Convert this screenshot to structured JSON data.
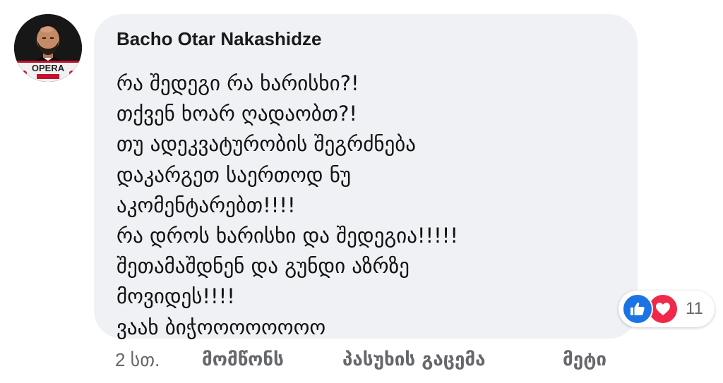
{
  "comment": {
    "author": "Bacho Otar Nakashidze",
    "avatar_text": "OPERA",
    "lines": [
      "რა შედეგი რა ხარისხი?!",
      "თქვენ ხოარ ღადაობთ?!",
      "თუ ადეკვატურობის შეგრძნება",
      "დაკარგეთ საერთოდ ნუ",
      "აკომენტარებთ!!!!",
      "რა დროს ხარისხი და შედეგია!!!!!",
      "შეთამაშდნენ და გუნდი აზრზე",
      "მოვიდეს!!!!",
      "ვაახ ბიჭოოოოოოოო"
    ],
    "reactions": {
      "icons": [
        "like-icon",
        "love-icon"
      ],
      "count": "11",
      "like_color": "#1b74e4",
      "love_color": "#f02849"
    },
    "actions": {
      "time": "2 სთ.",
      "like": "მომწონს",
      "reply": "პასუხის გაცემა",
      "more": "მეტი"
    }
  },
  "colors": {
    "bubble": "#eff1f4",
    "secondary_text": "#65676b",
    "text": "#111111"
  }
}
